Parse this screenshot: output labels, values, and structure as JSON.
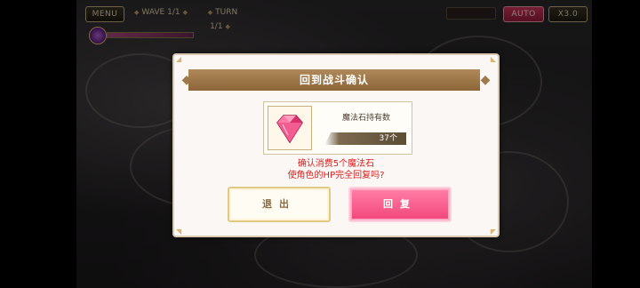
{
  "hud": {
    "menu_label": "MENU",
    "wave_label": "WAVE 1/1",
    "turn_label": "TURN 1/1",
    "auto_label": "AUTO",
    "speed_label": "X3.0"
  },
  "dialog": {
    "title": "回到战斗确认",
    "item_name": "魔法石持有数",
    "item_count": "37个",
    "confirm_line1": "确认消费5个魔法石",
    "confirm_line2": "使角色的HP完全回复吗?",
    "exit_label": "退出",
    "revive_label": "回复"
  },
  "colors": {
    "title_bar": "#9c774a",
    "confirm_text": "#d81f1f",
    "revive_button": "#f2457a",
    "exit_button_border": "#e0c885"
  },
  "icons": {
    "item": "magic-stone-gem-icon",
    "hp_orb": "player-orb-icon"
  }
}
